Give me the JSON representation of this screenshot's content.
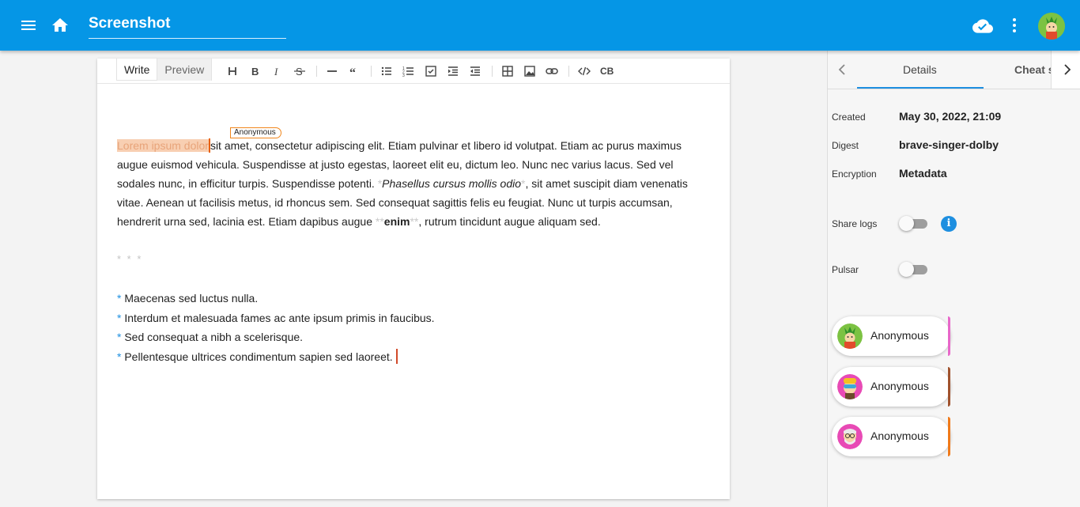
{
  "header": {
    "title": "Screenshot",
    "menu_icon": "menu-icon",
    "home_icon": "home-icon",
    "cloud_icon": "cloud-done-icon",
    "more_icon": "more-vert-icon"
  },
  "editor": {
    "tabs": {
      "write": "Write",
      "preview": "Preview"
    },
    "toolbar_code_block": "CB",
    "collaborator_flag": "Anonymous",
    "paragraph": {
      "selected": "Lorem ipsum dolor",
      "text1": "sit amet, consectetur adipiscing elit. Etiam pulvinar et libero id volutpat. Etiam ac purus maximus augue euismod vehicula. Suspendisse at justo egestas, laoreet elit eu, dictum leo. Nunc nec varius lacus. Sed vel sodales nunc, in efficitur turpis. Suspendisse potenti. ",
      "italic_mark_open": "*",
      "italic": "Phasellus cursus mollis odio",
      "italic_mark_close": "*",
      "text2": ", sit amet suscipit diam venenatis vitae. Aenean ut facilisis metus, id rhoncus sem. Sed consequat sagittis felis eu feugiat. Nunc ut turpis accumsan, hendrerit urna sed, lacinia est. Etiam dapibus augue ",
      "bold_mark_open": "**",
      "bold": "enim",
      "bold_mark_close": "**",
      "text3": ", rutrum tincidunt augue aliquam sed."
    },
    "hr": "* * *",
    "bullet_mark": "*",
    "list": [
      "Maecenas sed luctus nulla.",
      "Interdum et malesuada fames ac ante ipsum primis in faucibus.",
      "Sed consequat a nibh a scelerisque.",
      " Pellentesque ultrices condimentum sapien sed laoreet."
    ]
  },
  "side": {
    "tabs": {
      "details": "Details",
      "cheat": "Cheat s"
    },
    "props": {
      "created_label": "Created",
      "created_value": "May 30, 2022, 21:09",
      "digest_label": "Digest",
      "digest_value": "brave-singer-dolby",
      "encryption_label": "Encryption",
      "encryption_value": "Metadata",
      "share_logs_label": "Share logs",
      "pulsar_label": "Pulsar"
    },
    "share_logs_on": false,
    "pulsar_on": false,
    "info_glyph": "i",
    "users": [
      {
        "name": "Anonymous",
        "color": "#e867c9"
      },
      {
        "name": "Anonymous",
        "color": "#a0522d"
      },
      {
        "name": "Anonymous",
        "color": "#f07a1a"
      }
    ]
  },
  "colors": {
    "appbar": "#0596e6",
    "accent": "#1e8fe0",
    "cursor": "#e8600a"
  }
}
